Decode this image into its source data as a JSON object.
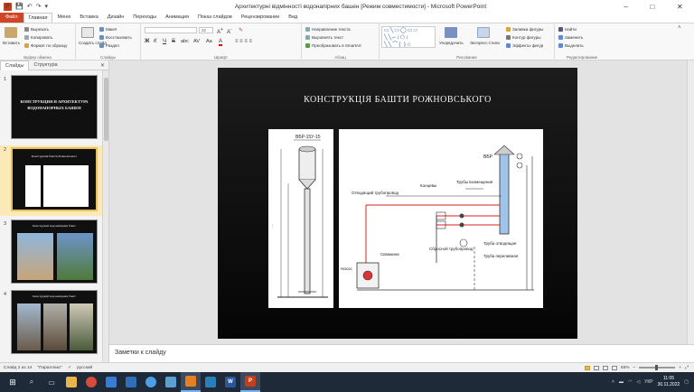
{
  "titlebar": {
    "title": "Архитектурні відмінності водонапірних башен [Режим совместимости] - Microsoft PowerPoint",
    "minimize": "–",
    "maximize": "□",
    "close": "✕"
  },
  "tabs": [
    "Файл",
    "Главная",
    "Меню",
    "Вставка",
    "Дизайн",
    "Переходы",
    "Анимация",
    "Показ слайдов",
    "Рецензирование",
    "Вид"
  ],
  "ribbon": {
    "clipboard": {
      "label": "Буфер обмена",
      "paste": "Вставить",
      "cut": "Вырезать",
      "copy": "Копировать",
      "format_painter": "Формат по образцу"
    },
    "slides": {
      "label": "Слайды",
      "new_slide": "Создать слайд",
      "layout": "Макет",
      "reset": "Восстановить",
      "section": "Раздел"
    },
    "font": {
      "label": "Шрифт",
      "font_name": "",
      "font_size": "32",
      "bold": "Ж",
      "italic": "К",
      "underline": "Ч",
      "strike": "S",
      "shadow": "abc",
      "spacing": "AV",
      "case": "Aa",
      "color": "A"
    },
    "paragraph": {
      "label": "Абзац",
      "direction": "Направление текста",
      "align_text": "Выровнять текст",
      "smartart": "Преобразовать в SmartArt"
    },
    "drawing": {
      "label": "Рисование",
      "arrange": "Упорядочить",
      "quick_styles": "Экспресс-стили",
      "fill": "Заливка фигуры",
      "outline": "Контур фигуры",
      "effects": "Эффекты фигур"
    },
    "editing": {
      "label": "Редактирование",
      "find": "Найти",
      "replace": "Заменить",
      "select": "Выделить"
    }
  },
  "panel": {
    "tab_slides": "Слайды",
    "tab_outline": "Структура",
    "close": "✕",
    "thumbs": [
      {
        "num": "1",
        "line1": "КОНСТРУКЦИЯ И АРХИТЕКТУРА",
        "line2": "ВОДОНАПОРНЫХ БАШЕН"
      },
      {
        "num": "2",
        "line1": "Конструкція башти Рожновського"
      },
      {
        "num": "3",
        "line1": "Конструкції водонапірних башт"
      },
      {
        "num": "4",
        "line1": "Конструкції водонапірних башт"
      }
    ]
  },
  "slide": {
    "title": "КОНСТРУКЦІЯ БАШТИ РОЖНОВСЬКОГО",
    "img1_caption": "ВБР-15У-15",
    "img2_labels": [
      "ВБР",
      "Отводящий трубопровод",
      "Концевы",
      "Трубы возмещения",
      "Сбросной трубопровод",
      "Труба отводящая",
      "Труба переливная",
      "Скважина",
      "Насос"
    ]
  },
  "notes": {
    "placeholder": "Заметки к слайду"
  },
  "status": {
    "slide_info": "Слайд 2 из 14",
    "theme": "\"Параллакс\"",
    "language": "русский",
    "zoom": "65%"
  },
  "taskbar": {
    "time": "11:05",
    "date": "30.11.2022",
    "lang": "УКР"
  }
}
